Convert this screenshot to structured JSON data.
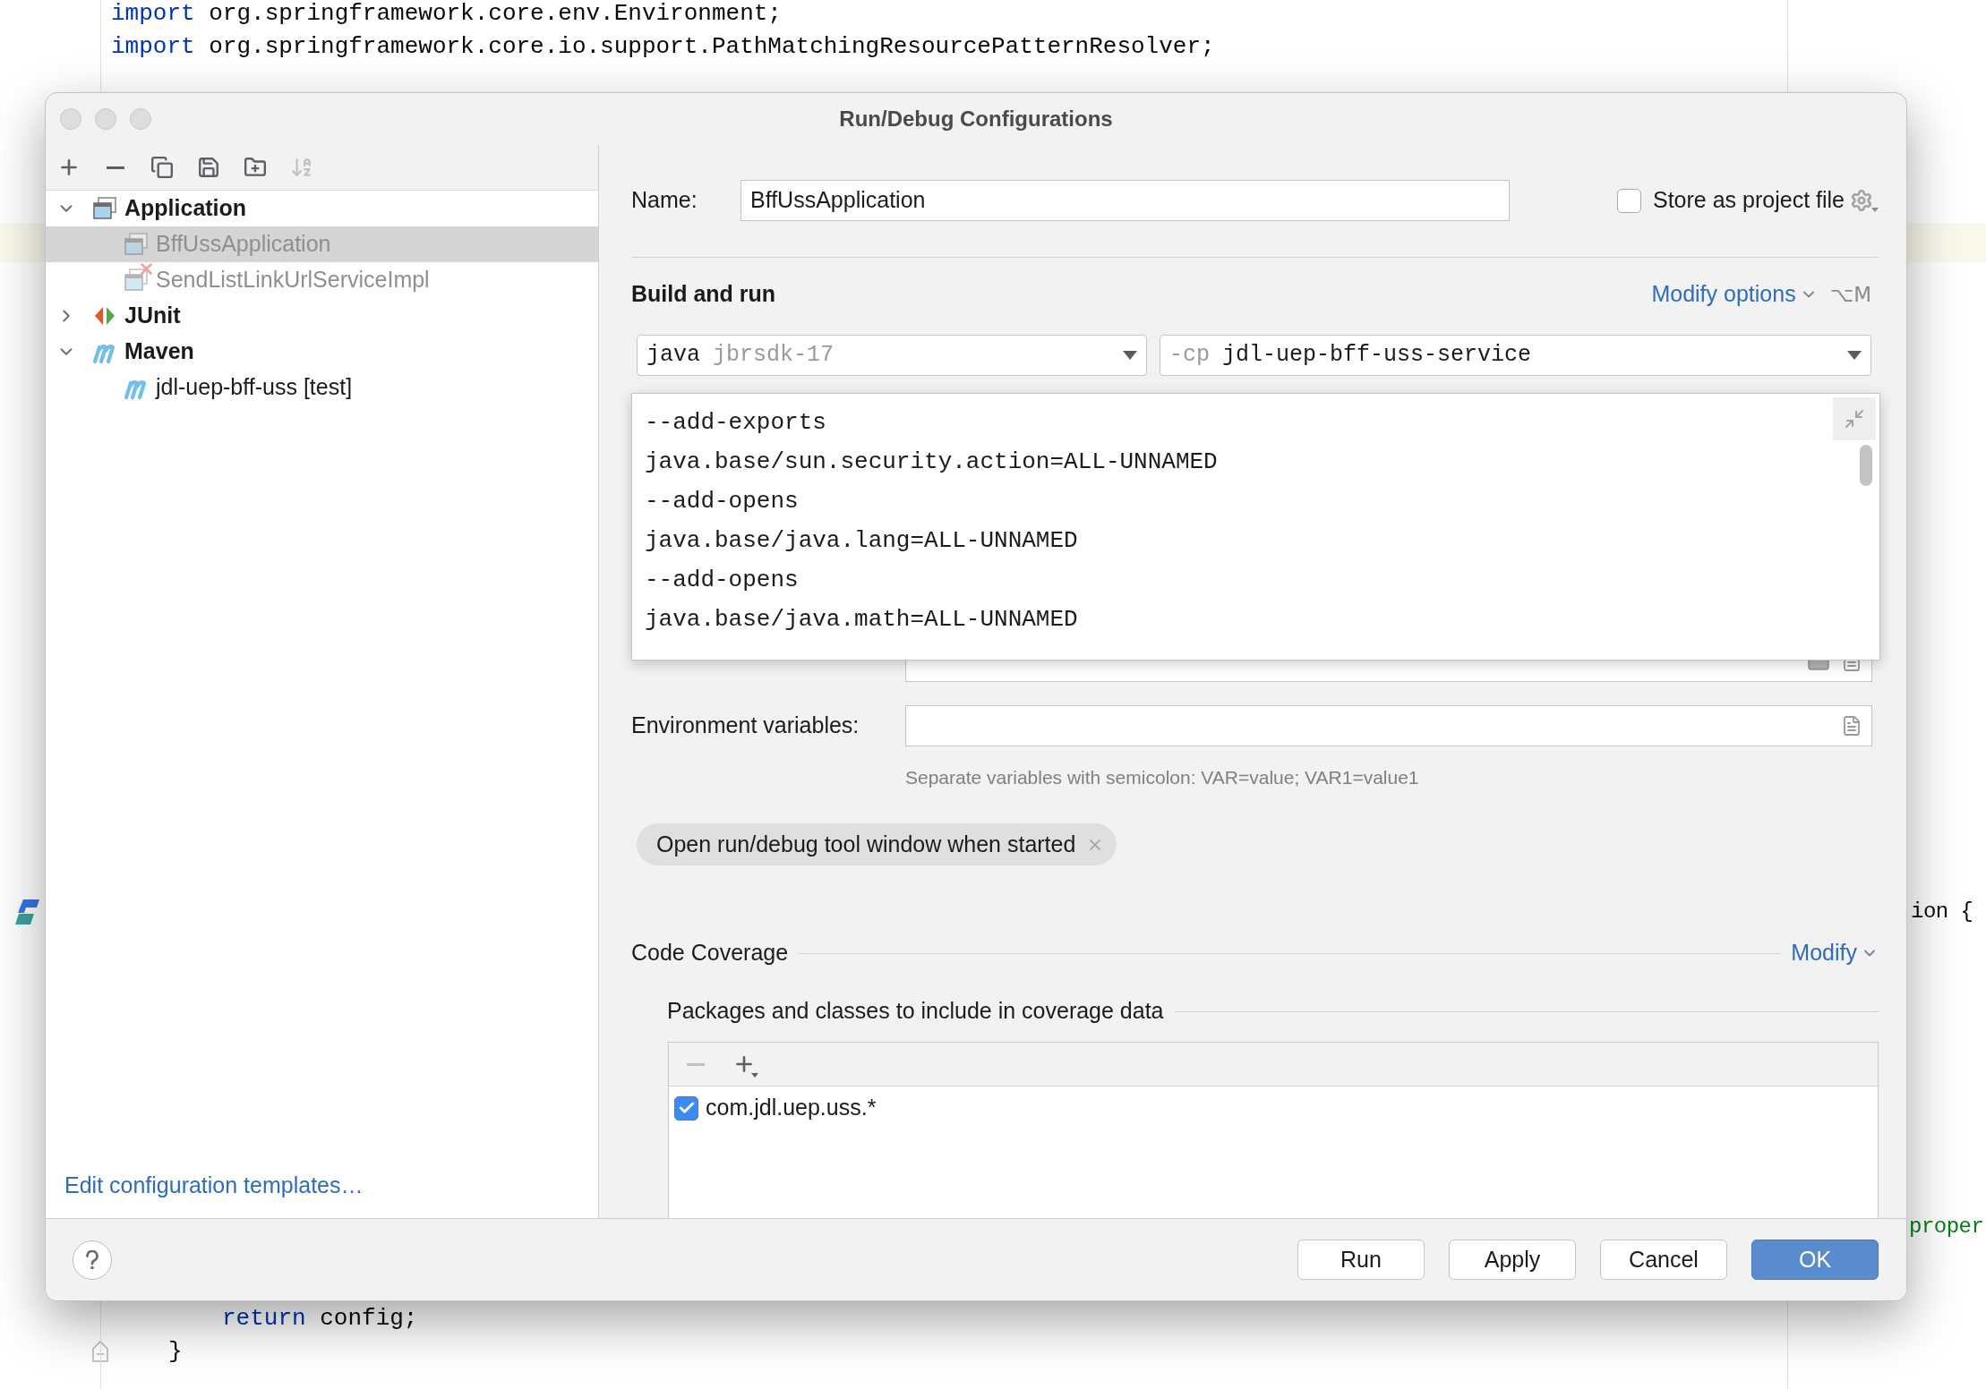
{
  "editor": {
    "top_lines": [
      {
        "keyword": "import",
        "code": "org.springframework.core.env.Environment;"
      },
      {
        "keyword": "import",
        "code": "org.springframework.core.io.support.PathMatchingResourcePatternResolver;"
      }
    ],
    "right_fragments": [
      {
        "kind": "plain",
        "code": "ion {"
      },
      {
        "kind": "string",
        "code": "proper"
      }
    ],
    "bottom_lines": [
      {
        "kind": "statement",
        "keyword": "return",
        "code": "config;"
      },
      {
        "kind": "block_end",
        "code": "}"
      }
    ]
  },
  "dialog": {
    "title": "Run/Debug Configurations",
    "sidebar": {
      "toolbar": [
        {
          "kind": "add",
          "disabled": false
        },
        {
          "kind": "remove",
          "disabled": false
        },
        {
          "kind": "copy",
          "disabled": false
        },
        {
          "kind": "save",
          "disabled": false
        },
        {
          "kind": "folder",
          "disabled": false
        },
        {
          "kind": "sort",
          "disabled": true
        }
      ],
      "tree": [
        {
          "label": "Application",
          "kind": "application",
          "expanded": true,
          "selected": false,
          "children": [
            {
              "label": "BffUssApplication",
              "kind": "application",
              "selected": true,
              "temporary": true,
              "error": false
            },
            {
              "label": "SendListLinkUrlServiceImpl",
              "kind": "application",
              "selected": false,
              "temporary": true,
              "error": true
            }
          ]
        },
        {
          "label": "JUnit",
          "kind": "junit",
          "expanded": false,
          "selected": false
        },
        {
          "label": "Maven",
          "kind": "maven",
          "expanded": true,
          "selected": false,
          "children": [
            {
              "label": "jdl-uep-bff-uss [test]",
              "kind": "maven",
              "selected": false,
              "temporary": false,
              "error": false
            }
          ]
        }
      ],
      "templates_link": "Edit configuration templates…"
    },
    "name": {
      "label": "Name:",
      "value": "BffUssApplication"
    },
    "store_as_project_file": {
      "label": "Store as project file",
      "checked": false
    },
    "build_and_run": {
      "title": "Build and run",
      "modify_link": "Modify options",
      "shortcut": "⌥M",
      "jre_select": {
        "value": "java",
        "hint": "jbrsdk-17"
      },
      "classpath_select": {
        "prefix": "-cp",
        "value": "jdl-uep-bff-uss-service"
      }
    },
    "vm_options_popup": {
      "lines": [
        "--add-exports",
        "java.base/sun.security.action=ALL-UNNAMED",
        "--add-opens",
        "java.base/java.lang=ALL-UNNAMED",
        "--add-opens",
        "java.base/java.math=ALL-UNNAMED"
      ]
    },
    "environment_variables": {
      "label": "Environment variables:",
      "hint": "Separate variables with semicolon: VAR=value; VAR1=value1"
    },
    "option_chips": [
      {
        "label": "Open run/debug tool window when started"
      }
    ],
    "code_coverage": {
      "title": "Code Coverage",
      "modify_link": "Modify",
      "packages_title": "Packages and classes to include in coverage data",
      "toolbar": [
        {
          "kind": "remove",
          "disabled": true
        },
        {
          "kind": "add",
          "disabled": false
        }
      ],
      "packages": [
        {
          "pattern": "com.jdl.uep.uss.*",
          "checked": true
        }
      ]
    },
    "buttons": [
      {
        "label": "Run",
        "primary": false
      },
      {
        "label": "Apply",
        "primary": false
      },
      {
        "label": "Cancel",
        "primary": false
      },
      {
        "label": "OK",
        "primary": true
      }
    ]
  }
}
